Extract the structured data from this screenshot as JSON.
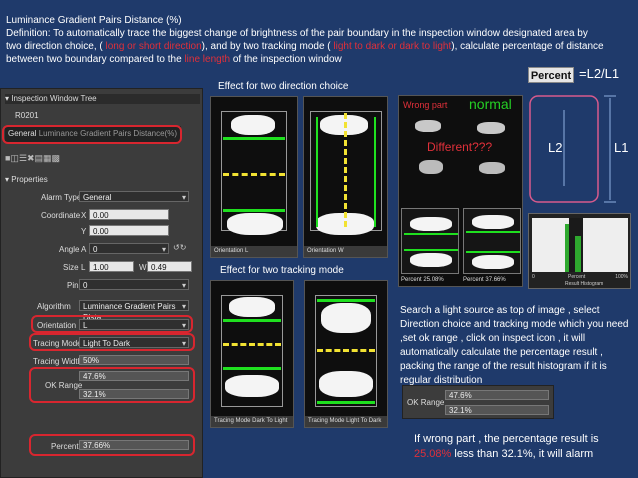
{
  "header": {
    "title": "Luminance Gradient Pairs Distance (%)",
    "def_part1": "Definition:  To automatically trace the biggest change of brightness of the pair boundary in the inspection window designated area by two direction choice, ( ",
    "def_red1": "long or short direction",
    "def_part2": "), and by two tracking mode ( ",
    "def_red2": "light to dark or dark to light",
    "def_part3": "), calculate percentage of distance between two boundary compared to the ",
    "def_red3": "line length",
    "def_part4": " of the inspection window"
  },
  "tree": {
    "title": "Inspection Window Tree",
    "root": "R0201",
    "item_prefix": "General",
    "item_label": "Luminance Gradient Pairs Distance(%)"
  },
  "props": {
    "title": "Properties",
    "alarm_type_label": "Alarm Type",
    "alarm_type": "General",
    "coordinate_label": "Coordinate",
    "x_label": "X",
    "x": "0.00",
    "y_label": "Y",
    "y": "0.00",
    "angle_label": "Angle",
    "a_label": "A",
    "angle": "0",
    "size_label": "Size",
    "l_label": "L",
    "l": "1.00",
    "w_label": "W",
    "w": "0.49",
    "pin_label": "Pin",
    "pin": "0",
    "algorithm_label": "Algorithm",
    "algorithm": "Luminance Gradient Pairs Dista",
    "orientation_label": "Orientation",
    "orientation": "L",
    "tracing_mode_label": "Tracing Mode",
    "tracing_mode": "Light To Dark",
    "tracing_width_label": "Tracing Width",
    "tracing_width": "50%",
    "ok_range_label": "OK Range",
    "ok_high": "47.6%",
    "ok_low": "32.1%",
    "percent_label": "Percent",
    "percent": "37.66%"
  },
  "direction": {
    "title": "Effect for two direction choice",
    "cap1_label": "Orientation",
    "cap1_val": "L",
    "cap2_label": "Orientation",
    "cap2_val": "W"
  },
  "tracking": {
    "title": "Effect for two tracking mode",
    "cap1_label": "Tracing Mode",
    "cap1_val": "Dark To Light",
    "cap2_label": "Tracing Mode",
    "cap2_val": "Light To Dark"
  },
  "compare": {
    "wrong": "Wrong part",
    "normal": "normal",
    "different": "Different???",
    "wrong_pct_label": "Percent",
    "wrong_pct": "25.08%",
    "normal_pct_label": "Percent",
    "normal_pct": "37.66%"
  },
  "formula": {
    "percent_badge": "Percent",
    "eq": "=L2/L1",
    "l2": "L2",
    "l1": "L1"
  },
  "histogram": {
    "left_label": "0",
    "center_label": "Percent",
    "sub_label": "Result Histogram",
    "right_label": "100%"
  },
  "search_text": "Search a light source as top of  image , select Direction choice and tracking mode which you need ,set ok range  ,  click on inspect icon  ,  it will automatically calculate the percentage result   ,  packing  the range of  the result histogram  if it is  regular distribution",
  "okbox": {
    "label": "OK Range",
    "high": "47.6%",
    "low": "32.1%"
  },
  "alarm": {
    "part1": "If wrong part , the percentage result is ",
    "red": "25.08%",
    "part2": "  less than 32.1%, it will alarm"
  }
}
